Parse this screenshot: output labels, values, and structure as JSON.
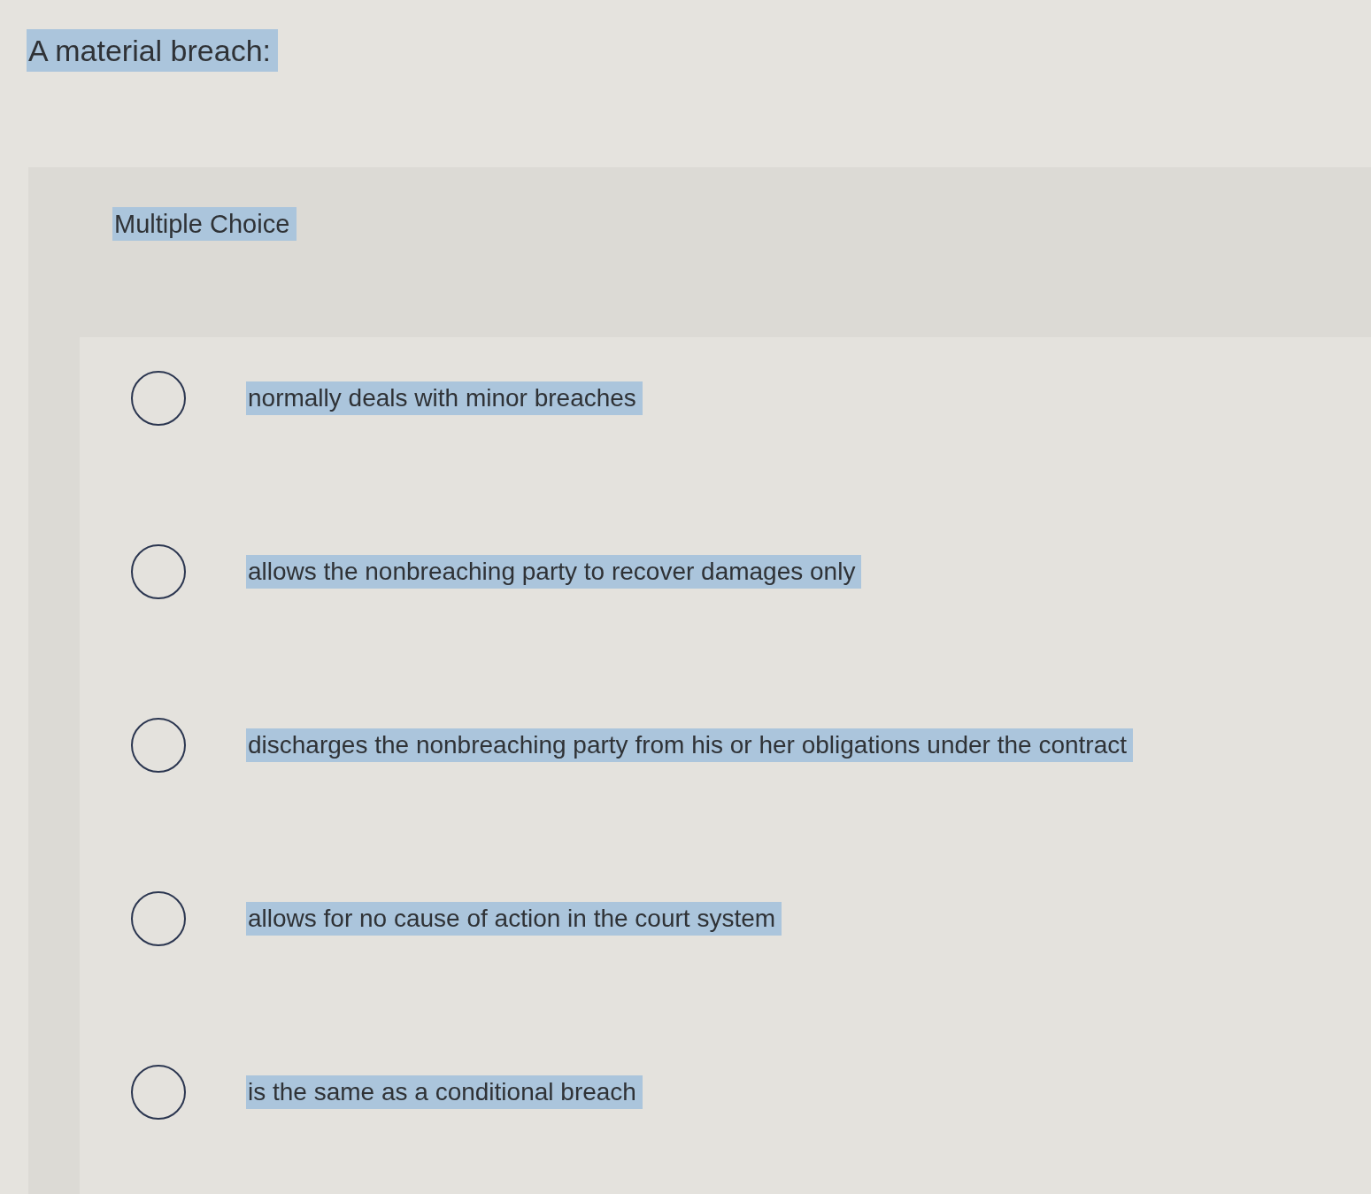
{
  "question": {
    "text": "A material breach:"
  },
  "question_type": "Multiple Choice",
  "options": [
    {
      "text": "normally deals with minor breaches",
      "selected": false
    },
    {
      "text": "allows the nonbreaching party to recover damages only",
      "selected": false
    },
    {
      "text": "discharges the nonbreaching party from his or her obligations under the contract",
      "selected": false
    },
    {
      "text": "allows for no cause of action in the court system",
      "selected": false
    },
    {
      "text": "is the same as a conditional breach",
      "selected": false
    }
  ]
}
